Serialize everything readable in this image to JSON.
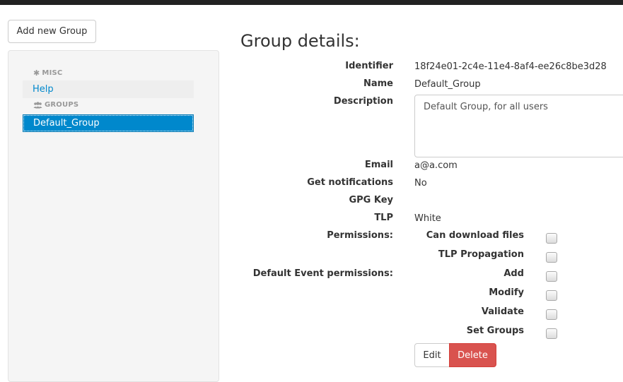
{
  "actions": {
    "add_new_group": "Add new Group"
  },
  "sidebar": {
    "misc_header": "MISC",
    "help_label": "Help",
    "groups_header": "GROUPS",
    "groups": [
      "Default_Group"
    ]
  },
  "details": {
    "title": "Group details:",
    "identifier_label": "Identifier",
    "identifier": "18f24e01-2c4e-11e4-8af4-ee26c8be3d28",
    "name_label": "Name",
    "name": "Default_Group",
    "description_label": "Description",
    "description": "Default Group, for all users",
    "email_label": "Email",
    "email": "a@a.com",
    "notifications_label": "Get notifications",
    "notifications": "No",
    "gpg_label": "GPG Key",
    "gpg": "",
    "tlp_label": "TLP",
    "tlp": "White"
  },
  "permissions": {
    "section_label": "Permissions:",
    "items": [
      {
        "label": "Can download files",
        "checked": false
      },
      {
        "label": "TLP Propagation",
        "checked": false
      }
    ]
  },
  "event_permissions": {
    "section_label": "Default Event permissions:",
    "items": [
      {
        "label": "Add",
        "checked": false
      },
      {
        "label": "Modify",
        "checked": false
      },
      {
        "label": "Validate",
        "checked": false
      },
      {
        "label": "Set Groups",
        "checked": false
      }
    ]
  },
  "buttons": {
    "edit": "Edit",
    "delete": "Delete"
  },
  "colors": {
    "primary": "#0088cc",
    "danger": "#d9534f",
    "topbar": "#222222"
  }
}
